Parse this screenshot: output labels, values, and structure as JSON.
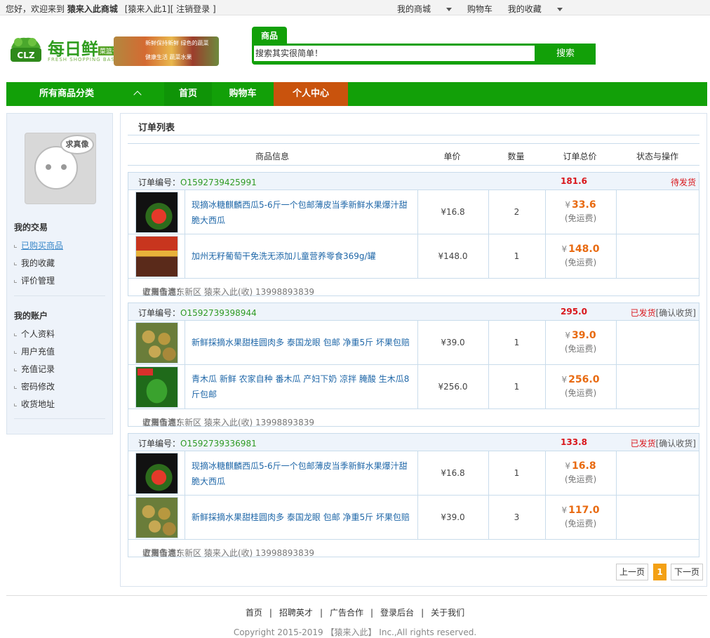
{
  "topbar": {
    "welcome": "您好，欢迎来到",
    "site_name": "猿来入此商城",
    "user": "[猿来入此1]",
    "logout": "[ 注销登录 ]",
    "my_mall": "我的商城",
    "cart": "购物车",
    "favorites": "我的收藏"
  },
  "logo": {
    "title": "每日鲜",
    "sub": "菜篮子",
    "en": "FRESH SHOPPING BASKET",
    "tag1": "新鲜保持新鲜 绿色的蔬菜",
    "tag2": "健康生活 蔬菜水果",
    "badge": "CLZ"
  },
  "search": {
    "tab": "商品",
    "placeholder": "搜索其实很简单！",
    "button": "搜索"
  },
  "nav": {
    "categories": "所有商品分类",
    "home": "首页",
    "cart": "购物车",
    "center": "个人中心"
  },
  "sidebar": {
    "avatar_text": "求真像",
    "trade_title": "我的交易",
    "trade_items": [
      "已购买商品",
      "我的收藏",
      "评价管理"
    ],
    "account_title": "我的账户",
    "account_items": [
      "个人资料",
      "用户充值",
      "充值记录",
      "密码修改",
      "收货地址"
    ]
  },
  "main": {
    "title": "订单列表",
    "columns": [
      "商品信息",
      "单价",
      "数量",
      "订单总价",
      "状态与操作"
    ],
    "order_no_label": "订单编号：",
    "yen": "¥",
    "free_ship": "(免运费)",
    "note_label": "订单备注：",
    "ship_prefix": "收货信息：",
    "orders": [
      {
        "no": "O1592739425991",
        "total": "181.6",
        "status": "待发货",
        "action": "",
        "items": [
          {
            "name": "现摘冰糖麒麟西瓜5-6斤一个包邮薄皮当季新鲜水果爆汁甜脆大西瓜",
            "price": "¥16.8",
            "qty": "2",
            "subtotal": "33.6",
            "image": "watermelon"
          },
          {
            "name": "加州无籽葡萄干免洗无添加儿童营养零食369g/罐",
            "price": "¥148.0",
            "qty": "1",
            "subtotal": "148.0",
            "image": "raisin"
          }
        ],
        "address": "上海市浦东新区 猿来入此(收) 13998893839"
      },
      {
        "no": "O1592739398944",
        "total": "295.0",
        "status": "已发货",
        "action": "[确认收货]",
        "items": [
          {
            "name": "新鲜採摘水果甜桂圆肉多 泰国龙眼 包邮 净重5斤 坏果包赔",
            "price": "¥39.0",
            "qty": "1",
            "subtotal": "39.0",
            "image": "longan"
          },
          {
            "name": "青木瓜 新鲜 农家自种 番木瓜 产妇下奶 凉拌 腌酸 生木瓜8斤包邮",
            "price": "¥256.0",
            "qty": "1",
            "subtotal": "256.0",
            "image": "papaya"
          }
        ],
        "address": "上海市浦东新区 猿来入此(收) 13998893839"
      },
      {
        "no": "O1592739336981",
        "total": "133.8",
        "status": "已发货",
        "action": "[确认收货]",
        "items": [
          {
            "name": "现摘冰糖麒麟西瓜5-6斤一个包邮薄皮当季新鲜水果爆汁甜脆大西瓜",
            "price": "¥16.8",
            "qty": "1",
            "subtotal": "16.8",
            "image": "watermelon"
          },
          {
            "name": "新鲜採摘水果甜桂圆肉多 泰国龙眼 包邮 净重5斤 坏果包赔",
            "price": "¥39.0",
            "qty": "3",
            "subtotal": "117.0",
            "image": "longan"
          }
        ],
        "address": "上海市浦东新区 猿来入此(收) 13998893839"
      }
    ]
  },
  "pager": {
    "prev": "上一页",
    "current": "1",
    "next": "下一页"
  },
  "footer": {
    "links": [
      "首页",
      "招聘英才",
      "广告合作",
      "登录后台",
      "关于我们"
    ],
    "separator": "|",
    "copyright": "Copyright 2015-2019 【猿来入此】 Inc.,All rights reserved."
  },
  "colors": {
    "brand": "#12a008",
    "active_tab": "#c9530d",
    "price": "#e86a10",
    "status": "#d9161b"
  }
}
